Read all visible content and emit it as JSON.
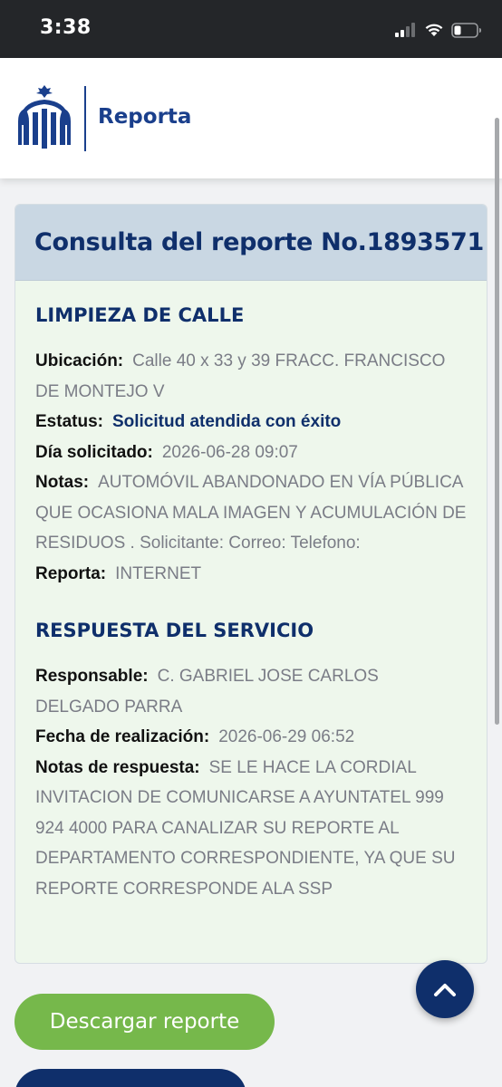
{
  "status_bar": {
    "time": "3:38",
    "icons": [
      "cellular-signal-icon",
      "wifi-icon",
      "battery-icon"
    ]
  },
  "header": {
    "title": "Reporta",
    "logo": "municipal-logo"
  },
  "report": {
    "title": "Consulta del reporte No.1893571",
    "category": "LIMPIEZA DE CALLE",
    "fields": {
      "ubicacion": {
        "label": "Ubicación:",
        "value": "Calle 40 x 33 y 39 FRACC. FRANCISCO DE MONTEJO V"
      },
      "estatus": {
        "label": "Estatus:",
        "value": "Solicitud atendida con éxito"
      },
      "dia": {
        "label": "Día solicitado:",
        "value": "2026-06-28 09:07"
      },
      "notas": {
        "label": "Notas:",
        "value": "AUTOMÓVIL ABANDONADO EN VÍA PÚBLICA QUE OCASIONA MALA IMAGEN Y ACUMULACIÓN DE RESIDUOS . Solicitante: Correo: Telefono:"
      },
      "reporta": {
        "label": "Reporta:",
        "value": "INTERNET"
      }
    }
  },
  "response": {
    "title": "RESPUESTA DEL SERVICIO",
    "fields": {
      "responsable": {
        "label": "Responsable:",
        "value": "C. GABRIEL JOSE CARLOS DELGADO PARRA"
      },
      "fecha": {
        "label": "Fecha de realización:",
        "value": "2026-06-29 06:52"
      },
      "notas_respuesta": {
        "label": "Notas de respuesta:",
        "value": "SE LE HACE LA CORDIAL INVITACION DE COMUNICARSE A AYUNTATEL 999 924 4000 PARA CANALIZAR SU REPORTE AL DEPARTAMENTO CORRESPONDIENTE, YA QUE SU REPORTE CORRESPONDE ALA SSP"
      }
    }
  },
  "actions": {
    "download_label": "Descargar reporte",
    "scroll_top_icon": "chevron-up-icon"
  },
  "colors": {
    "brand_navy": "#0f2f6b",
    "accent_green": "#76b84b",
    "card_bg": "#eef7ec",
    "card_header_bg": "#c9d7e3"
  }
}
